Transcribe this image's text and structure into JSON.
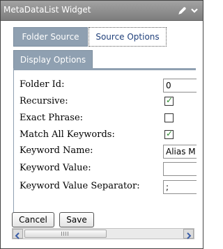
{
  "window": {
    "title": "MetaDataList Widget",
    "icons": [
      "edit-icon",
      "chevron-down-icon"
    ]
  },
  "tabs": [
    {
      "label": "Folder Source",
      "active": false
    },
    {
      "label": "Source Options",
      "active": true
    },
    {
      "label": "Display Options",
      "active": false
    }
  ],
  "form": {
    "folder_id": {
      "label": "Folder Id:",
      "value": "0"
    },
    "recursive": {
      "label": "Recursive:",
      "checked": true
    },
    "exact_phrase": {
      "label": "Exact Phrase:",
      "checked": false
    },
    "match_all_keywords": {
      "label": "Match All Keywords:",
      "checked": true
    },
    "keyword_name": {
      "label": "Keyword Name:",
      "value": "Alias M"
    },
    "keyword_value": {
      "label": "Keyword Value:",
      "value": ""
    },
    "keyword_value_separator": {
      "label": "Keyword Value Separator:",
      "value": ";"
    }
  },
  "buttons": {
    "cancel": "Cancel",
    "save": "Save"
  },
  "colors": {
    "tab_inactive": "#8fa0b1",
    "title_bar": "#8e8e8e",
    "check": "#2b8a2b"
  }
}
